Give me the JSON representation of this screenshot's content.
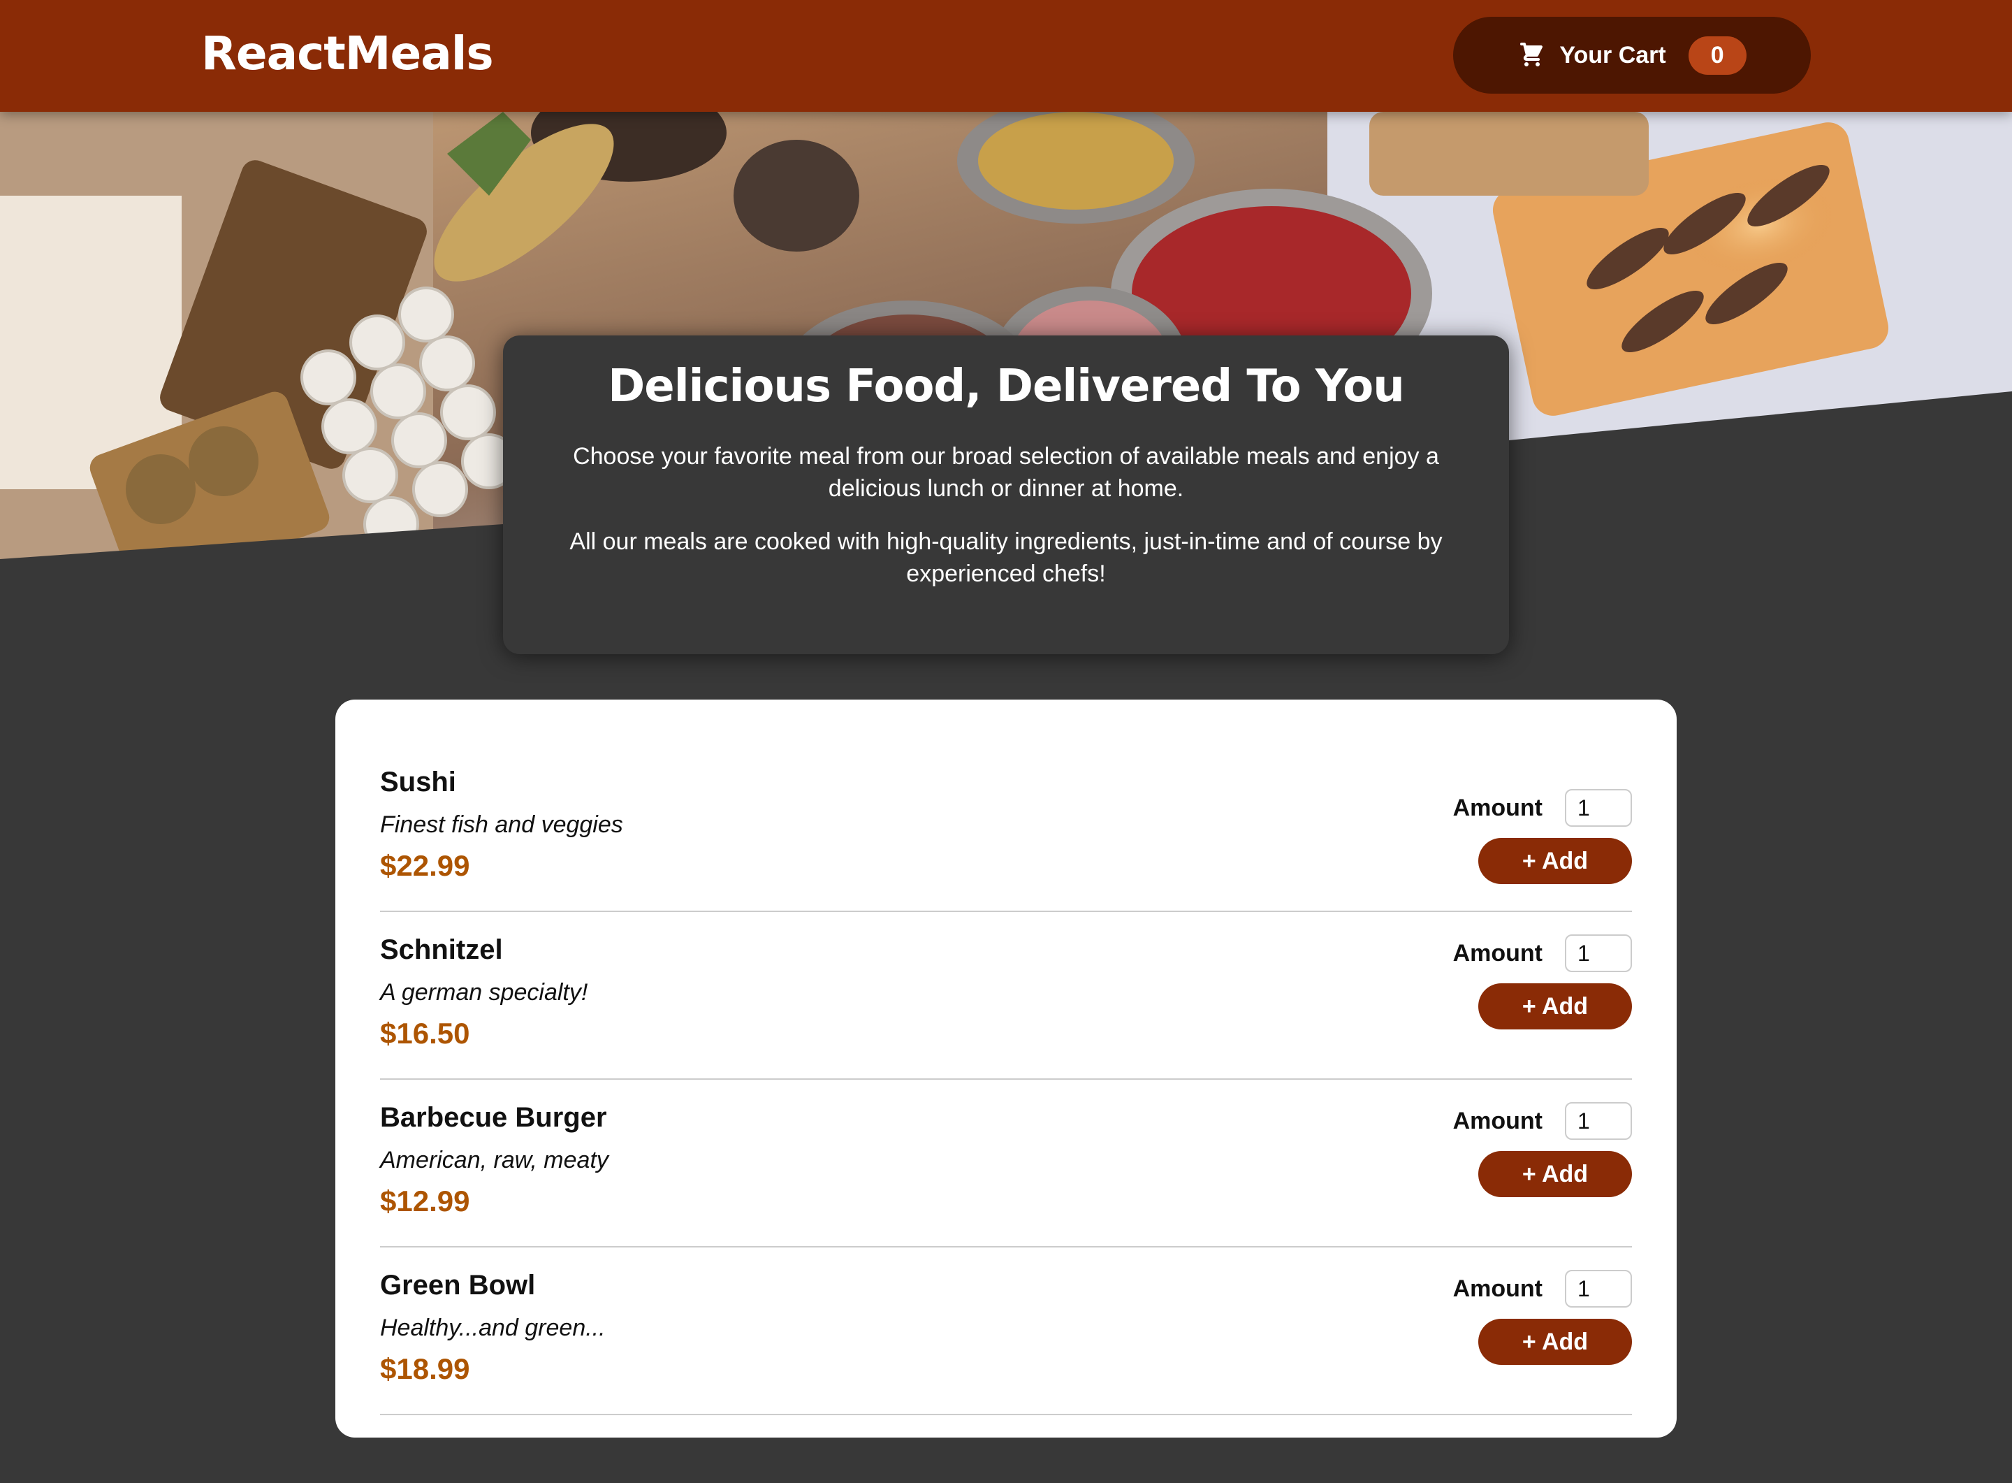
{
  "header": {
    "logo": "ReactMeals",
    "cart": {
      "icon": "cart-icon",
      "label": "Your Cart",
      "count": "0"
    }
  },
  "summary": {
    "title": "Delicious Food, Delivered To You",
    "paragraphs": [
      "Choose your favorite meal from our broad selection of available meals and enjoy a delicious lunch or dinner at home.",
      "All our meals are cooked with high-quality ingredients, just-in-time and of course by experienced chefs!"
    ]
  },
  "meals": [
    {
      "name": "Sushi",
      "description": "Finest fish and veggies",
      "price": "$22.99",
      "amount_label": "Amount",
      "amount_value": "1",
      "add_label": "+ Add"
    },
    {
      "name": "Schnitzel",
      "description": "A german specialty!",
      "price": "$16.50",
      "amount_label": "Amount",
      "amount_value": "1",
      "add_label": "+ Add"
    },
    {
      "name": "Barbecue Burger",
      "description": "American, raw, meaty",
      "price": "$12.99",
      "amount_label": "Amount",
      "amount_value": "1",
      "add_label": "+ Add"
    },
    {
      "name": "Green Bowl",
      "description": "Healthy...and green...",
      "price": "$18.99",
      "amount_label": "Amount",
      "amount_value": "1",
      "add_label": "+ Add"
    }
  ],
  "colors": {
    "header_bg": "#8a2b06",
    "cart_bg": "#4d1601",
    "badge_bg": "#b94517",
    "page_bg": "#383838",
    "price": "#ad5502",
    "add_button": "#8a2b06"
  }
}
